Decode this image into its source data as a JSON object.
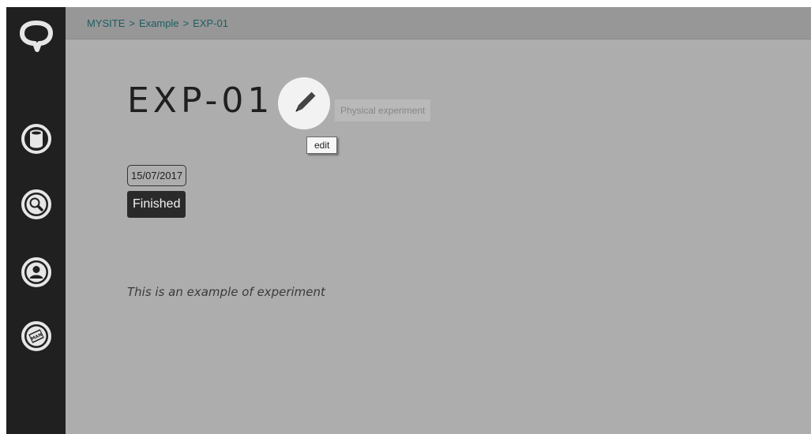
{
  "sidebar": {
    "items": [
      {
        "name": "logo",
        "icon": "speech-bubble-logo-icon"
      },
      {
        "name": "database",
        "icon": "database-icon"
      },
      {
        "name": "search",
        "icon": "search-icon"
      },
      {
        "name": "user",
        "icon": "user-icon"
      },
      {
        "name": "manual",
        "icon": "manual-book-icon",
        "icon_text": "MAN"
      }
    ]
  },
  "breadcrumb": {
    "items": [
      "MYSITE",
      "Example",
      "EXP-01"
    ],
    "separator": ">"
  },
  "experiment": {
    "title": "EXP-01",
    "type": "Physical experiment",
    "edit_tooltip": "edit",
    "date": "15/07/2017",
    "status": "Finished",
    "description": "This is an example of experiment"
  },
  "colors": {
    "sidebar_bg": "#202020",
    "topbar_bg": "#979797",
    "main_bg": "#adadad",
    "breadcrumb_link": "#1c5d63",
    "status_bg": "#2a2a2a"
  }
}
